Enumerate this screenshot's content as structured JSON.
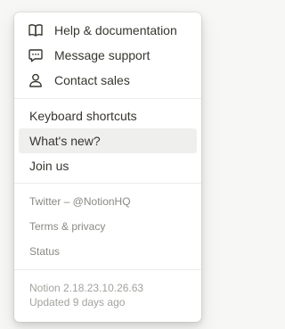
{
  "menu": {
    "primary": [
      {
        "label": "Help & documentation",
        "icon": "book-icon"
      },
      {
        "label": "Message support",
        "icon": "chat-bubble-icon"
      },
      {
        "label": "Contact sales",
        "icon": "person-icon"
      }
    ],
    "secondary": [
      {
        "label": "Keyboard shortcuts"
      },
      {
        "label": "What's new?",
        "highlighted": true
      },
      {
        "label": "Join us"
      }
    ],
    "links": [
      {
        "label": "Twitter – @NotionHQ"
      },
      {
        "label": "Terms & privacy"
      },
      {
        "label": "Status"
      }
    ],
    "footer": {
      "version": "Notion 2.18.23.10.26.63",
      "updated": "Updated 9 days ago"
    }
  },
  "colors": {
    "text": "#37352f",
    "muted_text": "#8a8985",
    "footer_text": "#a3a29e",
    "hover_bg": "#efefee",
    "divider": "#ececea"
  }
}
